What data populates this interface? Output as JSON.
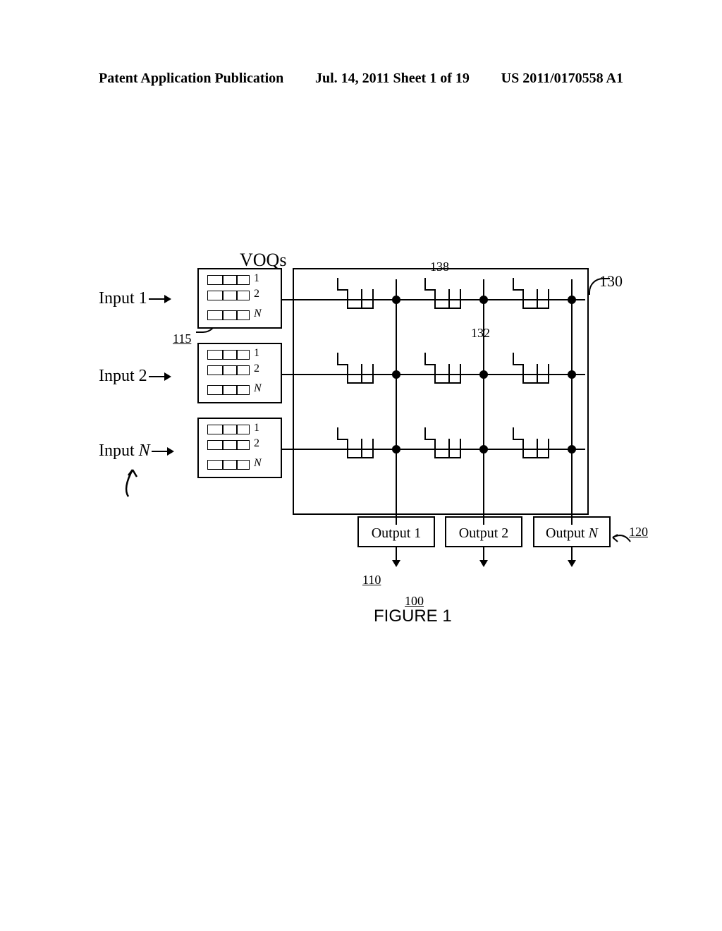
{
  "header": {
    "left": "Patent Application Publication",
    "center": "Jul. 14, 2011  Sheet 1 of 19",
    "right": "US 2011/0170558 A1"
  },
  "labels": {
    "voq_title": "VOQs",
    "input1": "Input 1",
    "input2": "Input 2",
    "inputN_prefix": "Input ",
    "inputN_suffix": "N",
    "q1": "1",
    "q2": "2",
    "qn": "N",
    "output1": "Output 1",
    "output2": "Output 2",
    "outputN_prefix": "Output ",
    "outputN_suffix": "N"
  },
  "refs": {
    "r100": "100",
    "r110": "110",
    "r115": "115",
    "r120": "120",
    "r130": "130",
    "r132": "132",
    "r138": "138"
  },
  "caption": "FIGURE 1"
}
